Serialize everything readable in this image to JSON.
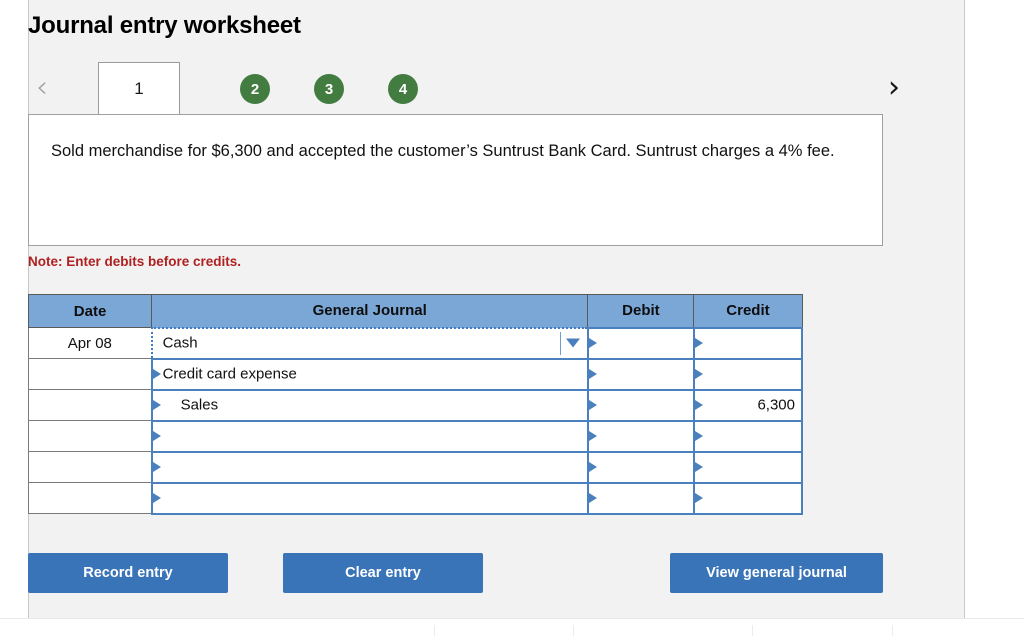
{
  "header": {
    "title": "Journal entry worksheet"
  },
  "nav": {
    "prev_icon": "chevron-left-icon",
    "next_icon": "chevron-right-icon",
    "prev_glyph": "‹",
    "next_glyph": "›"
  },
  "tabs": {
    "active_label": "1",
    "items": [
      {
        "label": "2"
      },
      {
        "label": "3"
      },
      {
        "label": "4"
      }
    ],
    "active_color": "#ffffff",
    "circle_color": "#437c40"
  },
  "scenario": {
    "text": "Sold merchandise for $6,300 and accepted the customer’s Suntrust Bank Card. Suntrust charges a 4% fee."
  },
  "note": {
    "text": "Note: Enter debits before credits.",
    "color": "#b02020"
  },
  "journal": {
    "columns": [
      "Date",
      "General Journal",
      "Debit",
      "Credit"
    ],
    "header_color": "#7ba7d7",
    "rows": [
      {
        "date": "Apr 08",
        "account": "Cash",
        "indent": false,
        "debit": "",
        "credit": "",
        "selected": true
      },
      {
        "date": "",
        "account": "Credit card expense",
        "indent": false,
        "debit": "",
        "credit": "",
        "selected": false
      },
      {
        "date": "",
        "account": "Sales",
        "indent": true,
        "debit": "",
        "credit": "6,300",
        "selected": false
      },
      {
        "date": "",
        "account": "",
        "indent": false,
        "debit": "",
        "credit": "",
        "selected": false
      },
      {
        "date": "",
        "account": "",
        "indent": false,
        "debit": "",
        "credit": "",
        "selected": false
      },
      {
        "date": "",
        "account": "",
        "indent": false,
        "debit": "",
        "credit": "",
        "selected": false
      }
    ]
  },
  "actions": {
    "record_label": "Record entry",
    "clear_label": "Clear entry",
    "view_label": "View general journal",
    "button_color": "#3a74b8"
  }
}
